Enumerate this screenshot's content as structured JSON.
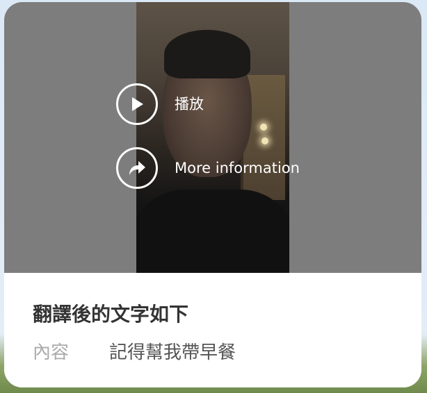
{
  "media": {
    "play_label": "播放",
    "more_info_label": "More information"
  },
  "content": {
    "title": "翻譯後的文字如下",
    "field_label": "內容",
    "field_value": "記得幫我帶早餐"
  },
  "icons": {
    "play": "play-icon",
    "share": "share-arrow-icon"
  },
  "colors": {
    "overlay_gray": "#7d7d7d",
    "card_background": "#ffffff",
    "title_text": "#333333",
    "label_text": "#aaaaaa",
    "value_text": "#555555"
  }
}
